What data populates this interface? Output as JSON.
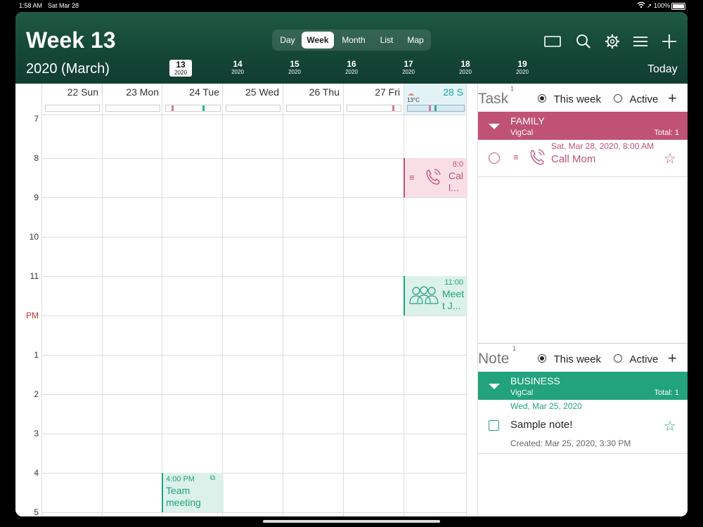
{
  "status_bar": {
    "time": "1:58 AM",
    "date": "Sat Mar 28",
    "battery": "100%"
  },
  "header": {
    "title": "Week 13",
    "subtitle": "2020 (March)",
    "views": [
      "Day",
      "Week",
      "Month",
      "List",
      "Map"
    ],
    "active_view": "Week",
    "weeks": [
      {
        "num": "13",
        "year": "2020"
      },
      {
        "num": "14",
        "year": "2020"
      },
      {
        "num": "15",
        "year": "2020"
      },
      {
        "num": "16",
        "year": "2020"
      },
      {
        "num": "17",
        "year": "2020"
      },
      {
        "num": "18",
        "year": "2020"
      },
      {
        "num": "19",
        "year": "2020"
      }
    ],
    "today_label": "Today"
  },
  "calendar": {
    "days": [
      "22 Sun",
      "23 Mon",
      "24 Tue",
      "25 Wed",
      "26 Thu",
      "27 Fri",
      "28 S"
    ],
    "hours": [
      "7",
      "8",
      "9",
      "10",
      "11",
      "PM",
      "1",
      "2",
      "3",
      "4",
      "5"
    ],
    "weather": "13°C",
    "events": {
      "call": {
        "time": "8:0",
        "title_1": "Cal",
        "title_2": "l..."
      },
      "meet": {
        "time": "11:00",
        "title_1": "Meet",
        "title_2": "t J..."
      },
      "team": {
        "time": "4:00 PM",
        "title_1": "Team",
        "title_2": "meeting"
      }
    }
  },
  "task_panel": {
    "title": "Task",
    "count": "1",
    "filter_week": "This week",
    "filter_active": "Active",
    "group": {
      "name": "FAMILY",
      "calendar": "VigCal",
      "total": "Total:  1"
    },
    "item": {
      "date": "Sat, Mar 28, 2020, 8:00 AM",
      "title": "Call Mom"
    }
  },
  "note_panel": {
    "title": "Note",
    "count": "1",
    "filter_week": "This week",
    "filter_active": "Active",
    "group": {
      "name": "BUSINESS",
      "calendar": "VigCal",
      "total": "Total:  1"
    },
    "item": {
      "date": "Wed, Mar 25, 2020",
      "title": "Sample note!",
      "created": "Created: Mar 25, 2020, 3:30 PM"
    }
  },
  "colors": {
    "header": "#164a39",
    "family": "#c05275",
    "business": "#22a27d",
    "accent_teal": "#1aa3a3"
  }
}
